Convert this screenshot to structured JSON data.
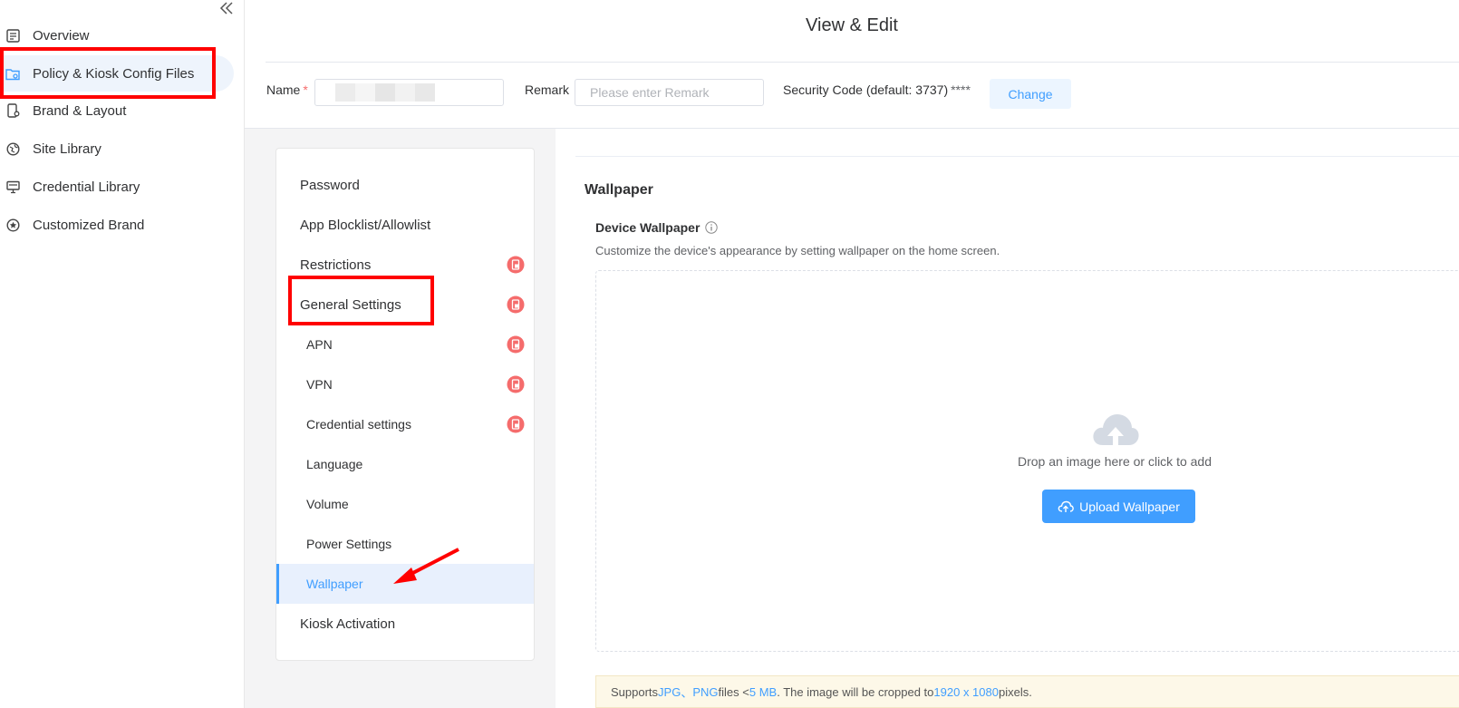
{
  "sidebar": {
    "collapse_icon": "double-chevron-left-icon",
    "items": [
      {
        "label": "Overview",
        "icon": "document-icon"
      },
      {
        "label": "Policy & Kiosk Config Files",
        "icon": "folder-gear-icon",
        "active": true
      },
      {
        "label": "Brand & Layout",
        "icon": "device-gear-icon"
      },
      {
        "label": "Site Library",
        "icon": "globe-icon"
      },
      {
        "label": "Credential Library",
        "icon": "monitor-icon"
      },
      {
        "label": "Customized Brand",
        "icon": "star-circle-icon"
      }
    ]
  },
  "header": {
    "title": "View & Edit",
    "name_label": "Name",
    "required_mark": "*",
    "name_value": "",
    "remark_label": "Remark",
    "remark_placeholder": "Please enter Remark",
    "security_label": "Security Code (default: 3737)",
    "security_mask": "****",
    "change_button": "Change"
  },
  "settings_menu": {
    "items": [
      {
        "label": "Password",
        "level": "top",
        "locked": false
      },
      {
        "label": "App Blocklist/Allowlist",
        "level": "top",
        "locked": false
      },
      {
        "label": "Restrictions",
        "level": "top",
        "locked": true
      },
      {
        "label": "General Settings",
        "level": "top",
        "locked": true
      },
      {
        "label": "APN",
        "level": "sub",
        "locked": true
      },
      {
        "label": "VPN",
        "level": "sub",
        "locked": true
      },
      {
        "label": "Credential settings",
        "level": "sub",
        "locked": true
      },
      {
        "label": "Language",
        "level": "sub",
        "locked": false
      },
      {
        "label": "Volume",
        "level": "sub",
        "locked": false
      },
      {
        "label": "Power Settings",
        "level": "sub",
        "locked": false
      },
      {
        "label": "Wallpaper",
        "level": "sub",
        "locked": false,
        "selected": true
      },
      {
        "label": "Kiosk Activation",
        "level": "top",
        "locked": false
      }
    ]
  },
  "main": {
    "section_title": "Wallpaper",
    "subsection_title": "Device Wallpaper",
    "description": "Customize the device's appearance by setting wallpaper on the home screen.",
    "drop_text": "Drop an image here or click to add",
    "upload_button": "Upload Wallpaper",
    "notice": {
      "prefix": "Supports ",
      "fmt1": "JPG",
      "sep": "、",
      "fmt2": "PNG",
      "mid1": " files <",
      "size": "5 MB",
      "mid2": ". The image will be cropped to ",
      "resolution": "1920 x 1080",
      "suffix": " pixels."
    }
  },
  "colors": {
    "accent": "#409eff",
    "lock_badge": "#f56c6c",
    "annotation": "#ff0000"
  }
}
